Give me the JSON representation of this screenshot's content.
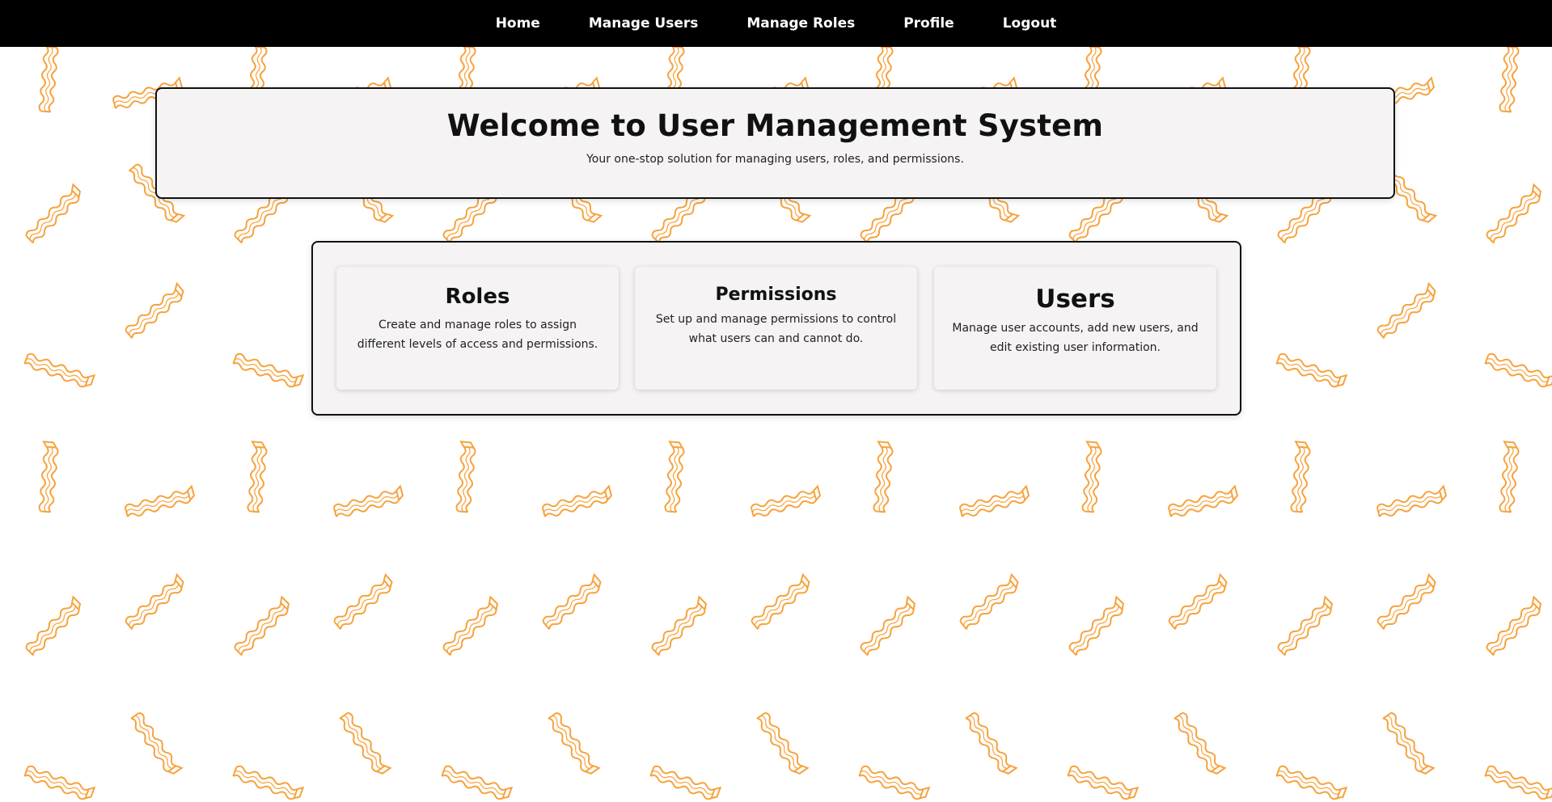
{
  "nav": {
    "items": [
      "Home",
      "Manage Users",
      "Manage Roles",
      "Profile",
      "Logout"
    ]
  },
  "hero": {
    "title": "Welcome to User Management System",
    "subtitle": "Your one-stop solution for managing users, roles, and permissions."
  },
  "features": {
    "roles": {
      "title": "Roles",
      "description": "Create and manage roles to assign different levels of access and permissions."
    },
    "permissions": {
      "title": "Permissions",
      "description": "Set up and manage permissions to control what users can and cannot do."
    },
    "users": {
      "title": "Users",
      "description": "Manage user accounts, add new users, and edit existing user information."
    }
  },
  "colors": {
    "navbar": "#000000",
    "pattern_stroke": "#f7a23c",
    "panel_background": "#f5f3f3"
  },
  "background": {
    "pattern_icon": "wavy-bacon-stick-icon"
  }
}
